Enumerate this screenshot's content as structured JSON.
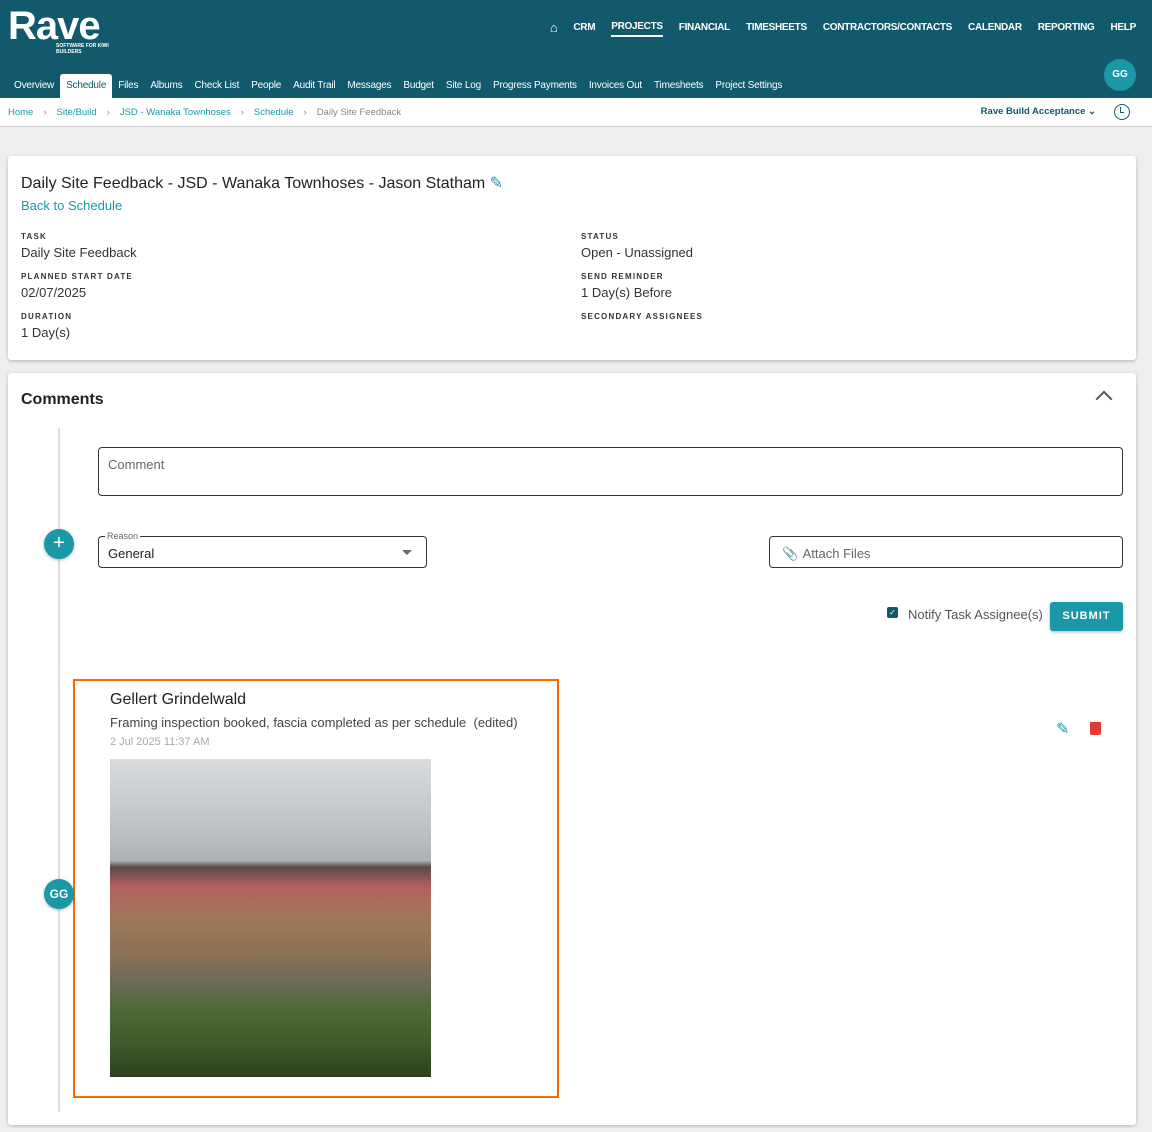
{
  "header": {
    "logo": "Rave",
    "logo_tagline": "SOFTWARE FOR KIWI BUILDERS",
    "top_nav": [
      "CRM",
      "PROJECTS",
      "FINANCIAL",
      "TIMESHEETS",
      "CONTRACTORS/CONTACTS",
      "CALENDAR",
      "REPORTING",
      "HELP"
    ],
    "active_top": "PROJECTS",
    "tabs": [
      "Overview",
      "Schedule",
      "Files",
      "Albums",
      "Check List",
      "People",
      "Audit Trail",
      "Messages",
      "Budget",
      "Site Log",
      "Progress Payments",
      "Invoices Out",
      "Timesheets",
      "Project Settings"
    ],
    "active_tab": "Schedule",
    "avatar": "GG"
  },
  "breadcrumb": {
    "items": [
      "Home",
      "Site/Build",
      "JSD - Wanaka Townhoses",
      "Schedule"
    ],
    "current": "Daily Site Feedback",
    "project_select": "Rave Build Acceptance"
  },
  "task": {
    "title": "Daily Site Feedback - JSD - Wanaka Townhoses - Jason Statham",
    "back_link": "Back to Schedule",
    "task_label": "TASK",
    "task": "Daily Site Feedback",
    "start_label": "PLANNED START DATE",
    "start": "02/07/2025",
    "duration_label": "DURATION",
    "duration": "1 Day(s)",
    "status_label": "STATUS",
    "status": "Open - Unassigned",
    "reminder_label": "SEND REMINDER",
    "reminder": "1 Day(s) Before",
    "secondary_label": "SECONDARY ASSIGNEES"
  },
  "comments": {
    "title": "Comments",
    "comment_placeholder": "Comment",
    "reason_label": "Reason",
    "reason_value": "General",
    "attach_label": "Attach Files",
    "notify_label": "Notify Task Assignee(s)",
    "notify_checked": true,
    "submit": "SUBMIT",
    "items": [
      {
        "author": "Gellert Grindelwald",
        "initials": "GG",
        "text": "Framing inspection booked, fascia completed as per schedule",
        "edited": "(edited)",
        "timestamp": "2 Jul 2025 11:37 AM"
      }
    ]
  },
  "colors": {
    "header": "#11596b",
    "accent": "#1b98a8",
    "delete": "#e53935",
    "highlight": "#ff6600"
  }
}
